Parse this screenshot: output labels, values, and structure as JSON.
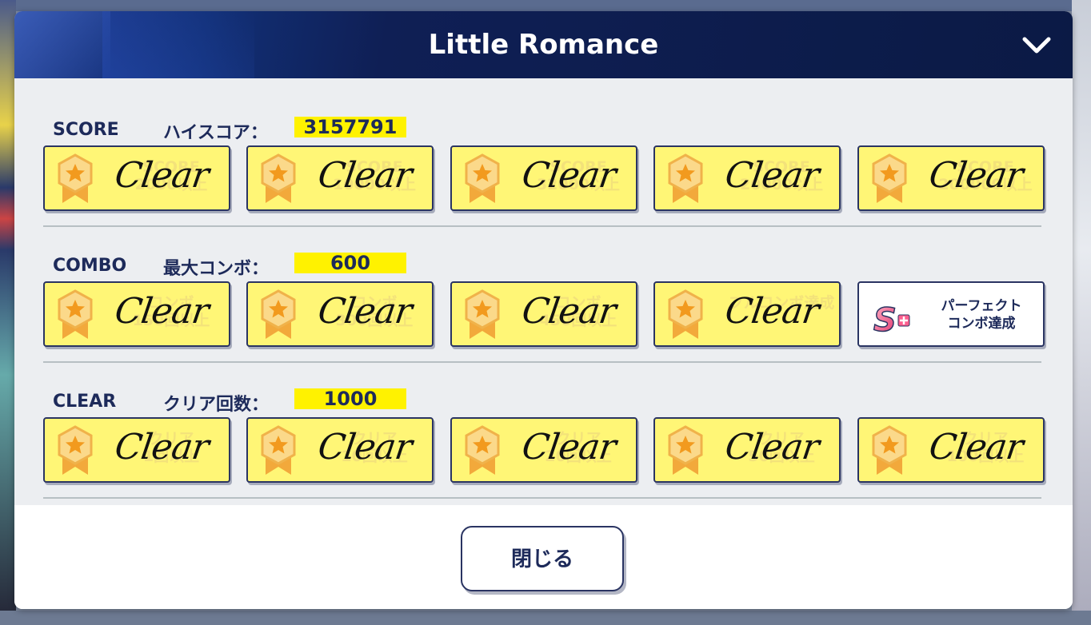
{
  "dialog": {
    "title": "Little Romance",
    "close_label": "閉じる"
  },
  "sections": [
    {
      "key": "SCORE",
      "label": "ハイスコア：",
      "value": "3157791",
      "badges": [
        {
          "status": "Clear",
          "ghost": "SCORE\n2000以上"
        },
        {
          "status": "Clear",
          "ghost": "SCORE\n10000以上"
        },
        {
          "status": "Clear",
          "ghost": "SCORE\n32000以上"
        },
        {
          "status": "Clear",
          "ghost": "SCORE\n20000以上"
        },
        {
          "status": "Clear",
          "ghost": "SCORE\n200000以上"
        }
      ]
    },
    {
      "key": "COMBO",
      "label": "最大コンボ：",
      "value": "600",
      "badges": [
        {
          "status": "Clear",
          "ghost": "コンボ\n150回以上"
        },
        {
          "status": "Clear",
          "ghost": "コンボ\n300回以上"
        },
        {
          "status": "Clear",
          "ghost": "コンボ\n450回以上"
        },
        {
          "status": "Clear",
          "ghost": "フルコンボ達成"
        },
        {
          "status": "パーフェクト\nコンボ達成",
          "ghost": ""
        }
      ]
    },
    {
      "key": "CLEAR",
      "label": "クリア回数：",
      "value": "1000",
      "badges": [
        {
          "status": "Clear",
          "ghost": "クリア\n1回以上"
        },
        {
          "status": "Clear",
          "ghost": "クリア\n10回以上"
        },
        {
          "status": "Clear",
          "ghost": "クリア\n20回以上"
        },
        {
          "status": "Clear",
          "ghost": "クリア\n50回以上"
        },
        {
          "status": "Clear",
          "ghost": "クリア\n100回以上"
        }
      ]
    }
  ],
  "colors": {
    "header_bg": "#0f1f55",
    "badge_bg": "#fff676",
    "value_highlight": "#fff200",
    "text_dark": "#1d2a5a"
  },
  "icons": {
    "collapse": "chevron-down-icon",
    "medal": "medal-star-icon",
    "perfect": "s-plus-icon"
  }
}
